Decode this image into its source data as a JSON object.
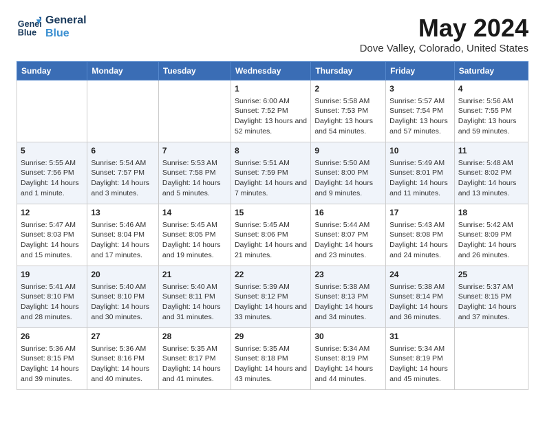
{
  "logo": {
    "line1": "General",
    "line2": "Blue"
  },
  "title": "May 2024",
  "subtitle": "Dove Valley, Colorado, United States",
  "header_days": [
    "Sunday",
    "Monday",
    "Tuesday",
    "Wednesday",
    "Thursday",
    "Friday",
    "Saturday"
  ],
  "weeks": [
    [
      {
        "day": "",
        "sunrise": "",
        "sunset": "",
        "daylight": ""
      },
      {
        "day": "",
        "sunrise": "",
        "sunset": "",
        "daylight": ""
      },
      {
        "day": "",
        "sunrise": "",
        "sunset": "",
        "daylight": ""
      },
      {
        "day": "1",
        "sunrise": "Sunrise: 6:00 AM",
        "sunset": "Sunset: 7:52 PM",
        "daylight": "Daylight: 13 hours and 52 minutes."
      },
      {
        "day": "2",
        "sunrise": "Sunrise: 5:58 AM",
        "sunset": "Sunset: 7:53 PM",
        "daylight": "Daylight: 13 hours and 54 minutes."
      },
      {
        "day": "3",
        "sunrise": "Sunrise: 5:57 AM",
        "sunset": "Sunset: 7:54 PM",
        "daylight": "Daylight: 13 hours and 57 minutes."
      },
      {
        "day": "4",
        "sunrise": "Sunrise: 5:56 AM",
        "sunset": "Sunset: 7:55 PM",
        "daylight": "Daylight: 13 hours and 59 minutes."
      }
    ],
    [
      {
        "day": "5",
        "sunrise": "Sunrise: 5:55 AM",
        "sunset": "Sunset: 7:56 PM",
        "daylight": "Daylight: 14 hours and 1 minute."
      },
      {
        "day": "6",
        "sunrise": "Sunrise: 5:54 AM",
        "sunset": "Sunset: 7:57 PM",
        "daylight": "Daylight: 14 hours and 3 minutes."
      },
      {
        "day": "7",
        "sunrise": "Sunrise: 5:53 AM",
        "sunset": "Sunset: 7:58 PM",
        "daylight": "Daylight: 14 hours and 5 minutes."
      },
      {
        "day": "8",
        "sunrise": "Sunrise: 5:51 AM",
        "sunset": "Sunset: 7:59 PM",
        "daylight": "Daylight: 14 hours and 7 minutes."
      },
      {
        "day": "9",
        "sunrise": "Sunrise: 5:50 AM",
        "sunset": "Sunset: 8:00 PM",
        "daylight": "Daylight: 14 hours and 9 minutes."
      },
      {
        "day": "10",
        "sunrise": "Sunrise: 5:49 AM",
        "sunset": "Sunset: 8:01 PM",
        "daylight": "Daylight: 14 hours and 11 minutes."
      },
      {
        "day": "11",
        "sunrise": "Sunrise: 5:48 AM",
        "sunset": "Sunset: 8:02 PM",
        "daylight": "Daylight: 14 hours and 13 minutes."
      }
    ],
    [
      {
        "day": "12",
        "sunrise": "Sunrise: 5:47 AM",
        "sunset": "Sunset: 8:03 PM",
        "daylight": "Daylight: 14 hours and 15 minutes."
      },
      {
        "day": "13",
        "sunrise": "Sunrise: 5:46 AM",
        "sunset": "Sunset: 8:04 PM",
        "daylight": "Daylight: 14 hours and 17 minutes."
      },
      {
        "day": "14",
        "sunrise": "Sunrise: 5:45 AM",
        "sunset": "Sunset: 8:05 PM",
        "daylight": "Daylight: 14 hours and 19 minutes."
      },
      {
        "day": "15",
        "sunrise": "Sunrise: 5:45 AM",
        "sunset": "Sunset: 8:06 PM",
        "daylight": "Daylight: 14 hours and 21 minutes."
      },
      {
        "day": "16",
        "sunrise": "Sunrise: 5:44 AM",
        "sunset": "Sunset: 8:07 PM",
        "daylight": "Daylight: 14 hours and 23 minutes."
      },
      {
        "day": "17",
        "sunrise": "Sunrise: 5:43 AM",
        "sunset": "Sunset: 8:08 PM",
        "daylight": "Daylight: 14 hours and 24 minutes."
      },
      {
        "day": "18",
        "sunrise": "Sunrise: 5:42 AM",
        "sunset": "Sunset: 8:09 PM",
        "daylight": "Daylight: 14 hours and 26 minutes."
      }
    ],
    [
      {
        "day": "19",
        "sunrise": "Sunrise: 5:41 AM",
        "sunset": "Sunset: 8:10 PM",
        "daylight": "Daylight: 14 hours and 28 minutes."
      },
      {
        "day": "20",
        "sunrise": "Sunrise: 5:40 AM",
        "sunset": "Sunset: 8:10 PM",
        "daylight": "Daylight: 14 hours and 30 minutes."
      },
      {
        "day": "21",
        "sunrise": "Sunrise: 5:40 AM",
        "sunset": "Sunset: 8:11 PM",
        "daylight": "Daylight: 14 hours and 31 minutes."
      },
      {
        "day": "22",
        "sunrise": "Sunrise: 5:39 AM",
        "sunset": "Sunset: 8:12 PM",
        "daylight": "Daylight: 14 hours and 33 minutes."
      },
      {
        "day": "23",
        "sunrise": "Sunrise: 5:38 AM",
        "sunset": "Sunset: 8:13 PM",
        "daylight": "Daylight: 14 hours and 34 minutes."
      },
      {
        "day": "24",
        "sunrise": "Sunrise: 5:38 AM",
        "sunset": "Sunset: 8:14 PM",
        "daylight": "Daylight: 14 hours and 36 minutes."
      },
      {
        "day": "25",
        "sunrise": "Sunrise: 5:37 AM",
        "sunset": "Sunset: 8:15 PM",
        "daylight": "Daylight: 14 hours and 37 minutes."
      }
    ],
    [
      {
        "day": "26",
        "sunrise": "Sunrise: 5:36 AM",
        "sunset": "Sunset: 8:15 PM",
        "daylight": "Daylight: 14 hours and 39 minutes."
      },
      {
        "day": "27",
        "sunrise": "Sunrise: 5:36 AM",
        "sunset": "Sunset: 8:16 PM",
        "daylight": "Daylight: 14 hours and 40 minutes."
      },
      {
        "day": "28",
        "sunrise": "Sunrise: 5:35 AM",
        "sunset": "Sunset: 8:17 PM",
        "daylight": "Daylight: 14 hours and 41 minutes."
      },
      {
        "day": "29",
        "sunrise": "Sunrise: 5:35 AM",
        "sunset": "Sunset: 8:18 PM",
        "daylight": "Daylight: 14 hours and 43 minutes."
      },
      {
        "day": "30",
        "sunrise": "Sunrise: 5:34 AM",
        "sunset": "Sunset: 8:19 PM",
        "daylight": "Daylight: 14 hours and 44 minutes."
      },
      {
        "day": "31",
        "sunrise": "Sunrise: 5:34 AM",
        "sunset": "Sunset: 8:19 PM",
        "daylight": "Daylight: 14 hours and 45 minutes."
      },
      {
        "day": "",
        "sunrise": "",
        "sunset": "",
        "daylight": ""
      }
    ]
  ]
}
